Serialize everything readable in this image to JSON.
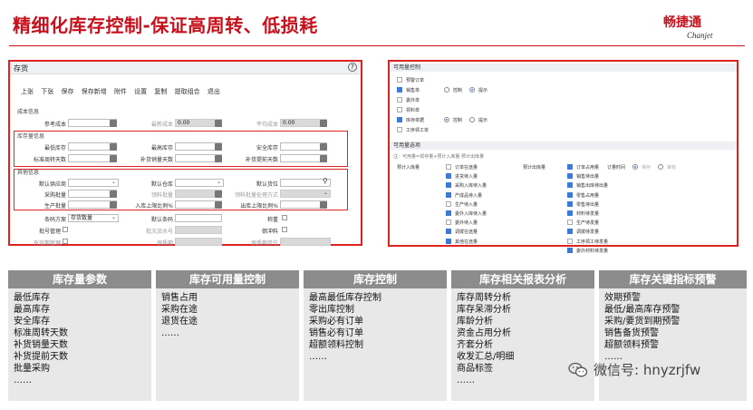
{
  "header": {
    "title": "精细化库存控制-保证高周转、低损耗",
    "logo_cn": "畅捷通",
    "logo_en": "Chanjet"
  },
  "left_window": {
    "title": "存货",
    "help": "?",
    "toolbar": [
      "上张",
      "下张",
      "保存",
      "保存新增",
      "附件",
      "设置",
      "复制",
      "提取组合",
      "退出"
    ],
    "cost_section": "成本信息",
    "cost_fields": [
      {
        "label": "参考成本",
        "value": ""
      },
      {
        "label": "最新成本",
        "value": "0.00"
      },
      {
        "label": "平均成本",
        "value": "0.00"
      }
    ],
    "stock_section": "库存量信息",
    "stock_row1": [
      {
        "label": "最低库存"
      },
      {
        "label": "最高库存"
      },
      {
        "label": "安全库存"
      }
    ],
    "stock_row2": [
      {
        "label": "标准周转天数"
      },
      {
        "label": "补货销量天数"
      },
      {
        "label": "补货提前天数"
      }
    ],
    "other_section": "其他信息",
    "other_row1": [
      {
        "label": "默认供应商"
      },
      {
        "label": "默认仓库"
      },
      {
        "label": "默认货位"
      }
    ],
    "other_row2": [
      {
        "label": "采购批量"
      },
      {
        "label": "领料批量"
      },
      {
        "label": "领料批量处理方式"
      }
    ],
    "other_row3": [
      {
        "label": "生产批量"
      },
      {
        "label": "入库上限比例%"
      },
      {
        "label": "出库上限比例%"
      }
    ],
    "extra_row1": {
      "label1": "条码方案",
      "value1": "存货数量",
      "label2": "默认条码",
      "label3": "称重"
    },
    "extra_row2": {
      "label1": "批号管理",
      "label2": "批次流水号",
      "label3": "倒冲料"
    },
    "extra_row3": {
      "label1": "有效期管理",
      "label2": "保质期",
      "label3": "保质期单位"
    }
  },
  "right_window": {
    "section1": "可用量控制",
    "items1": [
      {
        "label": "预警订单",
        "checked": false
      },
      {
        "label": "销售单",
        "checked": true
      },
      {
        "label": "委外单",
        "checked": false
      },
      {
        "label": "领料单",
        "checked": false
      },
      {
        "label": "库存单据",
        "checked": true
      },
      {
        "label": "工序领工单",
        "checked": false
      }
    ],
    "radio_a": "控制",
    "radio_b": "提示",
    "section2": "可用量选项",
    "note": "注：可用量=现存量+预计入库量-预计出库量",
    "in_label": "预计入库量",
    "out_label": "预计出库量",
    "in_items": [
      {
        "label": "订单在途量",
        "checked": false
      },
      {
        "label": "进货待入量",
        "checked": true
      },
      {
        "label": "采购入库待入量",
        "checked": true
      },
      {
        "label": "产成品待入量",
        "checked": true
      },
      {
        "label": "生产待入量",
        "checked": false
      },
      {
        "label": "委外入库待入量",
        "checked": true
      },
      {
        "label": "委外待入量",
        "checked": false
      },
      {
        "label": "调拨在途量",
        "checked": true
      },
      {
        "label": "其他在途量",
        "checked": true
      }
    ],
    "out_items": [
      {
        "label": "订单占用量",
        "checked": true
      },
      {
        "label": "销售待出量",
        "checked": true
      },
      {
        "label": "销售出库待出量",
        "checked": true
      },
      {
        "label": "零售占用量",
        "checked": true
      },
      {
        "label": "零售待出量",
        "checked": true
      },
      {
        "label": "材料待发量",
        "checked": true
      },
      {
        "label": "生产待发量",
        "checked": false
      },
      {
        "label": "调拨待发量",
        "checked": true
      },
      {
        "label": "工序领工待发量",
        "checked": false
      },
      {
        "label": "委外材料待发量",
        "checked": true
      }
    ],
    "lock_label": "订量时间",
    "lock_opt1": "保存",
    "lock_opt2": "审核"
  },
  "table": [
    {
      "head": "库存量参数",
      "rows": [
        "最低库存",
        "最高库存",
        "安全库存",
        "标准周转天数",
        "补货销量天数",
        "补货提前天数",
        "批量采购",
        "……"
      ]
    },
    {
      "head": "库存可用量控制",
      "rows": [
        "销售占用",
        "采购在途",
        "退货在途",
        "……"
      ]
    },
    {
      "head": "库存控制",
      "rows": [
        "最高最低库存控制",
        "零出库控制",
        "采购必有订单",
        "销售必有订单",
        "超额领料控制",
        "……"
      ]
    },
    {
      "head": "库存相关报表分析",
      "rows": [
        "库存周转分析",
        "库存呆滞分析",
        "库龄分析",
        "资金占用分析",
        "齐套分析",
        "收发汇总/明细",
        "商品标签",
        "……"
      ]
    },
    {
      "head": "库存关键指标预警",
      "rows": [
        "效期预警",
        "最低/最高库存预警",
        "采购/要货到期预警",
        "销售备货预警",
        "超额领料预警",
        "……"
      ]
    }
  ],
  "watermark": "微信号: hnyzrjfw"
}
